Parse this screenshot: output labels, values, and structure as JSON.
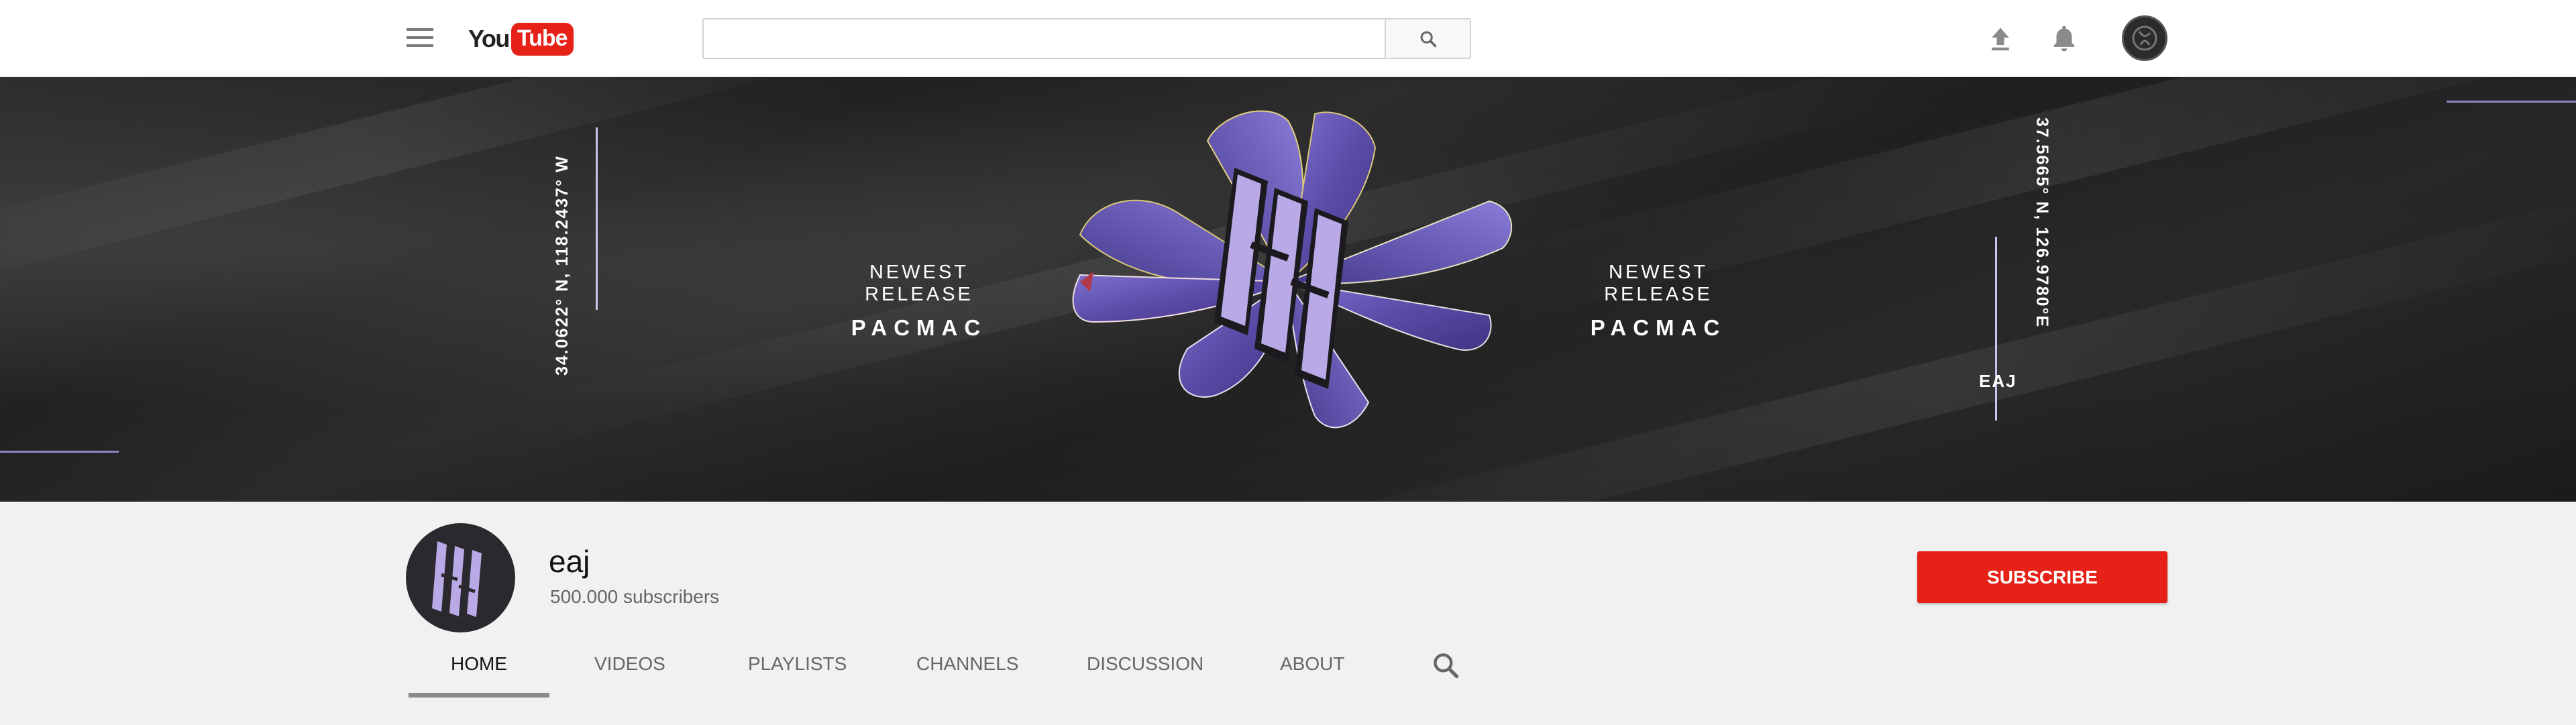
{
  "topbar": {
    "logo_you": "You",
    "logo_tube": "Tube",
    "search_placeholder": "",
    "icons": [
      "menu-icon",
      "search-icon",
      "upload-icon",
      "bell-icon",
      "account-avatar"
    ]
  },
  "banner": {
    "coord_left": "34.0622° N, 118.2437° W",
    "coord_right": "37.5665° N, 126.9780°E",
    "release_label": "NEWEST RELEASE",
    "release_title": "PACMAC",
    "tag": "EAJ",
    "logo_text": "EAJ"
  },
  "channel": {
    "name": "eaj",
    "subscribers": "500.000 subscribers",
    "subscribe_label": "SUBSCRIBE"
  },
  "tabs": [
    {
      "label": "HOME",
      "active": true
    },
    {
      "label": "VIDEOS",
      "active": false
    },
    {
      "label": "PLAYLISTS",
      "active": false
    },
    {
      "label": "CHANNELS",
      "active": false
    },
    {
      "label": "DISCUSSION",
      "active": false
    },
    {
      "label": "ABOUT",
      "active": false
    }
  ],
  "colors": {
    "accent_red": "#e62117",
    "banner_line": "#c9c4ea",
    "flower_purple": "#6b5bb8",
    "logo_lavender": "#b9a9e6"
  }
}
